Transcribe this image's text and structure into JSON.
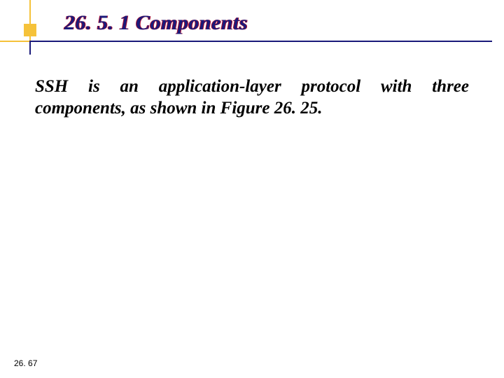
{
  "header": {
    "title": "26. 5. 1  Components"
  },
  "body": {
    "paragraph": "SSH is an application-layer protocol with three components, as shown in Figure 26. 25."
  },
  "footer": {
    "page_number": "26. 67"
  }
}
